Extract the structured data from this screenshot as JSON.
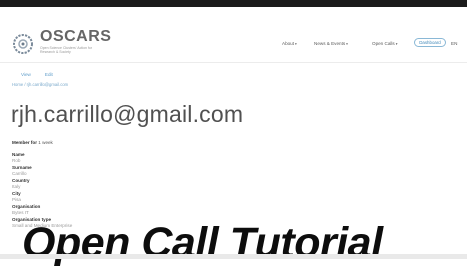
{
  "header": {
    "logo_title": "OSCARS",
    "logo_subtitle": "Open Science Clusters' Action for Research & Society",
    "nav": [
      {
        "label": "About"
      },
      {
        "label": "News & Events"
      },
      {
        "label": "Open Calls"
      }
    ],
    "dashboard_label": "Dashboard",
    "language": "EN"
  },
  "tabs": [
    {
      "label": "View"
    },
    {
      "label": "Edit"
    }
  ],
  "breadcrumb": "Home / rjh.carrillo@gmail.com",
  "user": {
    "email": "rjh.carrillo@gmail.com",
    "member_for_label": "Member for",
    "member_for_value": "1 week"
  },
  "fields": [
    {
      "label": "Name",
      "value": "Rob"
    },
    {
      "label": "Surname",
      "value": "Carrillo"
    },
    {
      "label": "Country",
      "value": "Italy"
    },
    {
      "label": "City",
      "value": "Pisa"
    },
    {
      "label": "Organisation",
      "value": "Bytes IT"
    },
    {
      "label": "Organisation type",
      "value": "Small and Medium Enterprise"
    }
  ],
  "overlay_title": "Open Call Tutorial",
  "colors": {
    "link": "#5f9dca",
    "dashboard_border": "#8ab8d6",
    "text_dark": "#333333",
    "text_muted": "#9a9a9a"
  }
}
